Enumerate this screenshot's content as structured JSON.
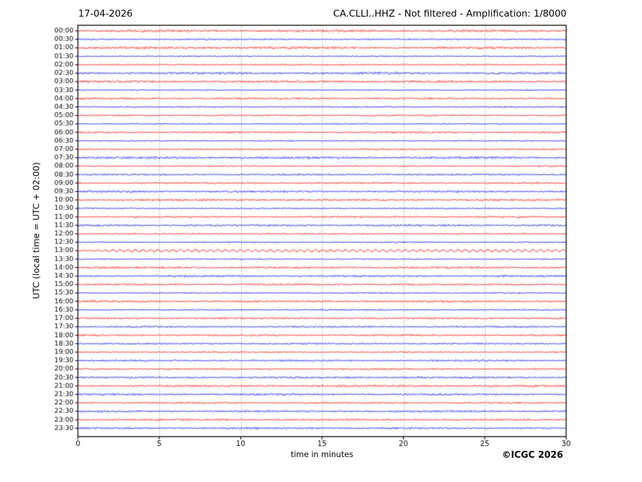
{
  "chart_data": {
    "type": "line",
    "subtype": "helicorder-daily-seismogram",
    "title_left": "17-04-2026",
    "title_right": "CA.CLLI..HHZ - Not filtered - Amplification: 1/8000",
    "xlabel": "time in minutes",
    "ylabel": "UTC (local time = UTC + 02:00)",
    "copyright": "©ICGC 2026",
    "xlim": [
      0,
      30
    ],
    "x_ticks": [
      0,
      5,
      10,
      15,
      20,
      25,
      30
    ],
    "grid_minutes": [
      5,
      10,
      15,
      20,
      25
    ],
    "grid_style": "vertical dotted lines only",
    "legend": "none",
    "colors": {
      "red_trace": "#ff0000",
      "blue_trace": "#0000ff",
      "axis": "#000000",
      "grid": "#777777",
      "background": "#ffffff"
    },
    "event": {
      "row_label": "13:00",
      "row_index": 26,
      "description": "low-amplitude harmonic oscillation across the row",
      "span_minutes": [
        1,
        30
      ]
    },
    "rows": [
      {
        "label": "00:00",
        "color": "red"
      },
      {
        "label": "00:30",
        "color": "blue"
      },
      {
        "label": "01:00",
        "color": "red"
      },
      {
        "label": "01:30",
        "color": "blue"
      },
      {
        "label": "02:00",
        "color": "red"
      },
      {
        "label": "02:30",
        "color": "blue"
      },
      {
        "label": "03:00",
        "color": "red"
      },
      {
        "label": "03:30",
        "color": "blue"
      },
      {
        "label": "04:00",
        "color": "red"
      },
      {
        "label": "04:30",
        "color": "blue"
      },
      {
        "label": "05:00",
        "color": "red"
      },
      {
        "label": "05:30",
        "color": "blue"
      },
      {
        "label": "06:00",
        "color": "red"
      },
      {
        "label": "06:30",
        "color": "blue"
      },
      {
        "label": "07:00",
        "color": "red"
      },
      {
        "label": "07:30",
        "color": "blue"
      },
      {
        "label": "08:00",
        "color": "red"
      },
      {
        "label": "08:30",
        "color": "blue"
      },
      {
        "label": "09:00",
        "color": "red"
      },
      {
        "label": "09:30",
        "color": "blue"
      },
      {
        "label": "10:00",
        "color": "red"
      },
      {
        "label": "10:30",
        "color": "blue"
      },
      {
        "label": "11:00",
        "color": "red"
      },
      {
        "label": "11:30",
        "color": "blue"
      },
      {
        "label": "12:00",
        "color": "red"
      },
      {
        "label": "12:30",
        "color": "blue"
      },
      {
        "label": "13:00",
        "color": "red"
      },
      {
        "label": "13:30",
        "color": "blue"
      },
      {
        "label": "14:00",
        "color": "red"
      },
      {
        "label": "14:30",
        "color": "blue"
      },
      {
        "label": "15:00",
        "color": "red"
      },
      {
        "label": "15:30",
        "color": "blue"
      },
      {
        "label": "16:00",
        "color": "red"
      },
      {
        "label": "16:30",
        "color": "blue"
      },
      {
        "label": "17:00",
        "color": "red"
      },
      {
        "label": "17:30",
        "color": "blue"
      },
      {
        "label": "18:00",
        "color": "red"
      },
      {
        "label": "18:30",
        "color": "blue"
      },
      {
        "label": "19:00",
        "color": "red"
      },
      {
        "label": "19:30",
        "color": "blue"
      },
      {
        "label": "20:00",
        "color": "red"
      },
      {
        "label": "20:30",
        "color": "blue"
      },
      {
        "label": "21:00",
        "color": "red"
      },
      {
        "label": "21:30",
        "color": "blue"
      },
      {
        "label": "22:00",
        "color": "red"
      },
      {
        "label": "22:30",
        "color": "blue"
      },
      {
        "label": "23:00",
        "color": "red"
      },
      {
        "label": "23:30",
        "color": "blue"
      }
    ]
  }
}
